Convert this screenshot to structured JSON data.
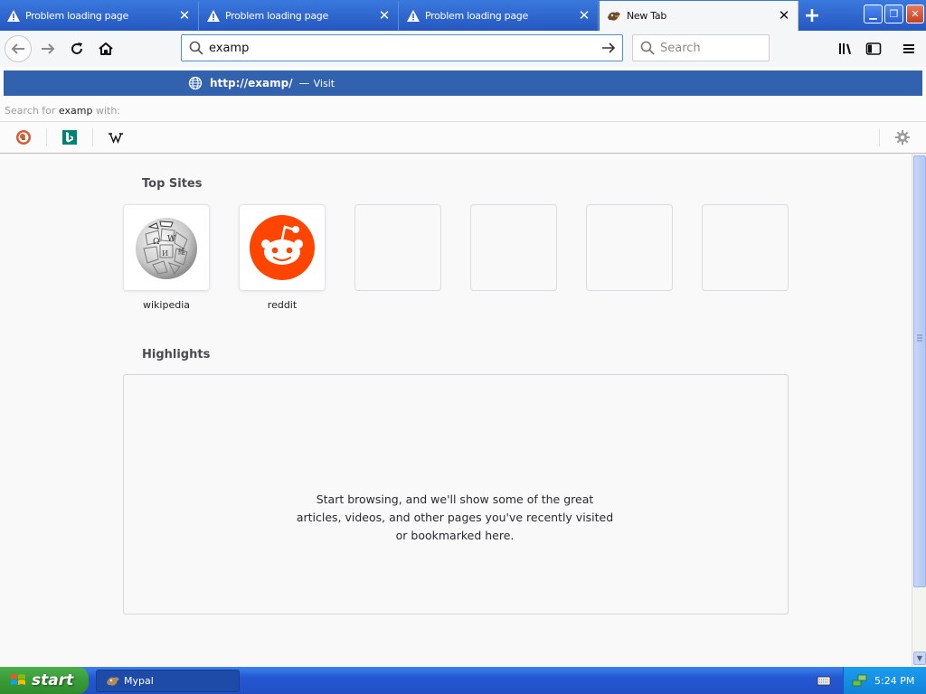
{
  "tabs": [
    {
      "title": "Problem loading page",
      "icon": "warning-icon",
      "selected": false
    },
    {
      "title": "Problem loading page",
      "icon": "warning-icon",
      "selected": false
    },
    {
      "title": "Problem loading page",
      "icon": "warning-icon",
      "selected": false
    },
    {
      "title": "New Tab",
      "icon": "mypal-icon",
      "selected": true
    }
  ],
  "tab_close_glyph": "✕",
  "newtab_glyph": "+",
  "window_controls": {
    "minimize": "▁",
    "maximize": "❐",
    "close": "✕"
  },
  "navbar": {
    "url_value": "examp",
    "search_placeholder": "Search"
  },
  "url_popup": {
    "suggestion_url": "http://examp/",
    "suggestion_sep": "—",
    "suggestion_action": "Visit",
    "search_for_prefix": "Search for ",
    "search_for_term": "examp",
    "search_for_suffix": " with:",
    "engines": [
      "duckduckgo-icon",
      "bing-icon",
      "wikipedia-icon"
    ]
  },
  "content": {
    "top_sites_title": "Top Sites",
    "top_sites": [
      {
        "label": "wikipedia",
        "icon": "wikipedia-globe-icon"
      },
      {
        "label": "reddit",
        "icon": "reddit-icon"
      },
      {
        "label": "",
        "icon": ""
      },
      {
        "label": "",
        "icon": ""
      },
      {
        "label": "",
        "icon": ""
      },
      {
        "label": "",
        "icon": ""
      }
    ],
    "highlights_title": "Highlights",
    "highlights_message": "Start browsing, and we'll show some of the great articles, videos, and other pages you've recently visited or bookmarked here."
  },
  "taskbar": {
    "start_label": "start",
    "task_label": "Mypal",
    "clock": "5:24 PM"
  },
  "colors": {
    "tabstrip": "#2c62c9",
    "suggestion_highlight": "#3262ae",
    "reddit": "#ff4500",
    "start_green": "#3a9a38"
  }
}
